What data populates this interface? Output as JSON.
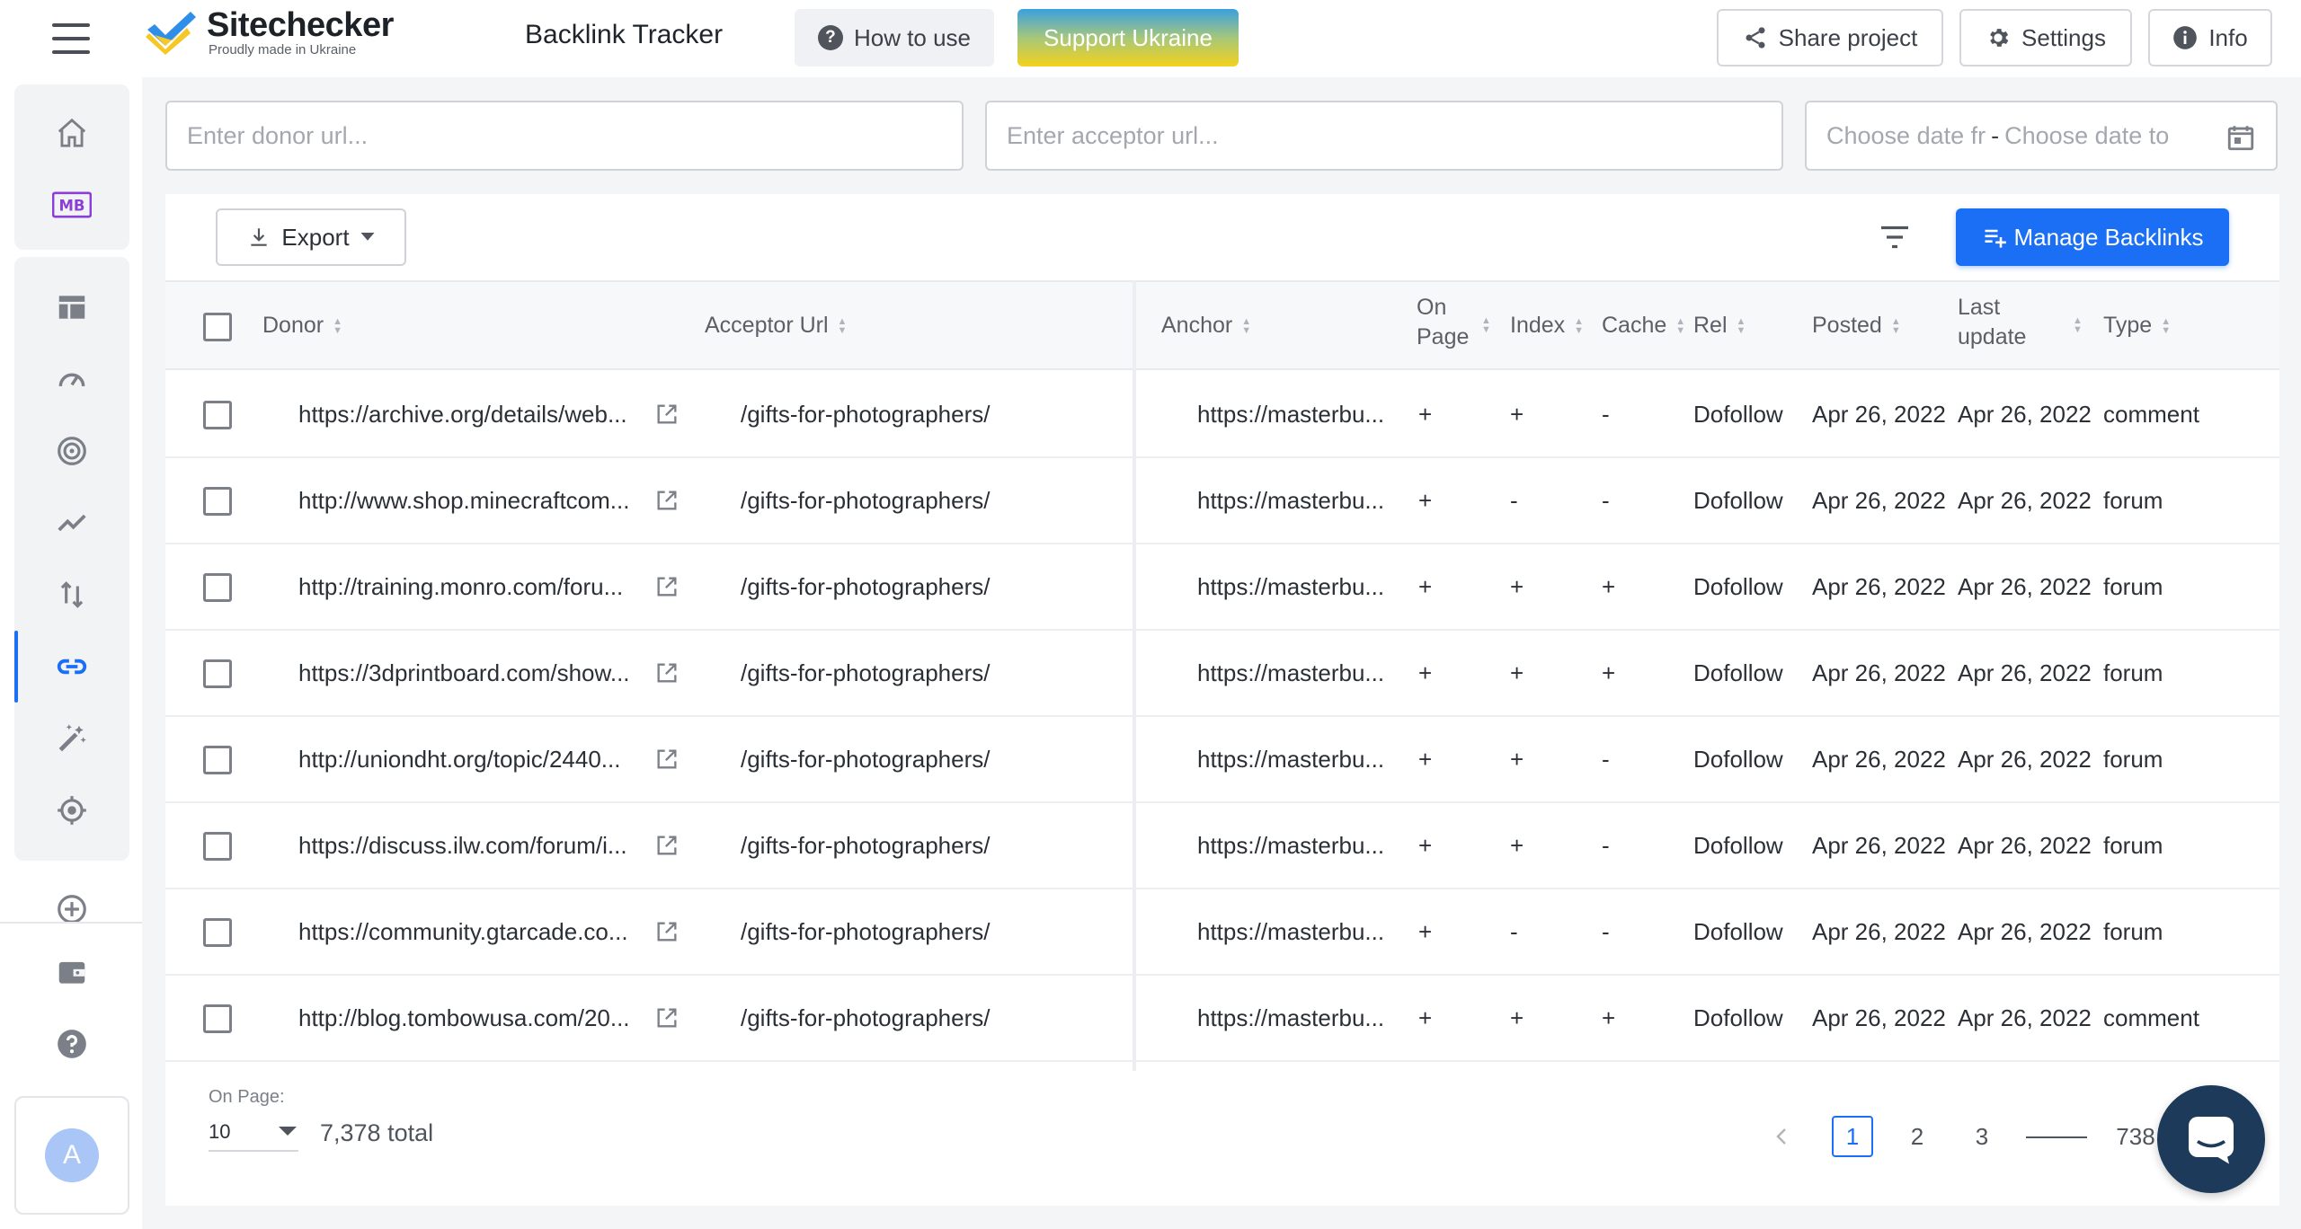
{
  "brand": {
    "name": "Sitechecker",
    "tagline": "Proudly made in Ukraine"
  },
  "header": {
    "app_title": "Backlink Tracker",
    "how_to_use": "How to use",
    "support_ukraine": "Support Ukraine",
    "share": "Share project",
    "settings": "Settings",
    "info": "Info"
  },
  "sidebar": {
    "items": [
      "home-icon",
      "mb-logo",
      "table-icon",
      "speedometer-icon",
      "target-icon",
      "trend-icon",
      "sort-arrows-icon",
      "link-icon",
      "magic-wand-icon",
      "crosshair-icon",
      "add-circle-icon",
      "wallet-icon",
      "help-icon"
    ],
    "active": "link-icon",
    "avatar_letter": "A",
    "mb_label": "MB"
  },
  "filters": {
    "donor_placeholder": "Enter donor url...",
    "acceptor_placeholder": "Enter acceptor url...",
    "date_from_placeholder": "Choose date fr",
    "date_separator": "-",
    "date_to_placeholder": "Choose date to"
  },
  "toolbar": {
    "export": "Export",
    "manage": "Manage Backlinks"
  },
  "table": {
    "columns": {
      "donor": "Donor",
      "acceptor": "Acceptor Url",
      "anchor": "Anchor",
      "onpage_1": "On",
      "onpage_2": "Page",
      "index": "Index",
      "cache": "Cache",
      "rel": "Rel",
      "posted": "Posted",
      "lastupdate_1": "Last",
      "lastupdate_2": "update",
      "type": "Type"
    },
    "rows": [
      {
        "donor": "https://archive.org/details/web...",
        "acceptor": "/gifts-for-photographers/",
        "anchor": "https://masterbu...",
        "onpage": "+",
        "index": "+",
        "cache": "-",
        "rel": "Dofollow",
        "posted": "Apr 26, 2022",
        "updated": "Apr 26, 2022",
        "type": "comment"
      },
      {
        "donor": "http://www.shop.minecraftcom...",
        "acceptor": "/gifts-for-photographers/",
        "anchor": "https://masterbu...",
        "onpage": "+",
        "index": "-",
        "cache": "-",
        "rel": "Dofollow",
        "posted": "Apr 26, 2022",
        "updated": "Apr 26, 2022",
        "type": "forum"
      },
      {
        "donor": "http://training.monro.com/foru...",
        "acceptor": "/gifts-for-photographers/",
        "anchor": "https://masterbu...",
        "onpage": "+",
        "index": "+",
        "cache": "+",
        "rel": "Dofollow",
        "posted": "Apr 26, 2022",
        "updated": "Apr 26, 2022",
        "type": "forum"
      },
      {
        "donor": "https://3dprintboard.com/show...",
        "acceptor": "/gifts-for-photographers/",
        "anchor": "https://masterbu...",
        "onpage": "+",
        "index": "+",
        "cache": "+",
        "rel": "Dofollow",
        "posted": "Apr 26, 2022",
        "updated": "Apr 26, 2022",
        "type": "forum"
      },
      {
        "donor": "http://uniondht.org/topic/2440...",
        "acceptor": "/gifts-for-photographers/",
        "anchor": "https://masterbu...",
        "onpage": "+",
        "index": "+",
        "cache": "-",
        "rel": "Dofollow",
        "posted": "Apr 26, 2022",
        "updated": "Apr 26, 2022",
        "type": "forum"
      },
      {
        "donor": "https://discuss.ilw.com/forum/i...",
        "acceptor": "/gifts-for-photographers/",
        "anchor": "https://masterbu...",
        "onpage": "+",
        "index": "+",
        "cache": "-",
        "rel": "Dofollow",
        "posted": "Apr 26, 2022",
        "updated": "Apr 26, 2022",
        "type": "forum"
      },
      {
        "donor": "https://community.gtarcade.co...",
        "acceptor": "/gifts-for-photographers/",
        "anchor": "https://masterbu...",
        "onpage": "+",
        "index": "-",
        "cache": "-",
        "rel": "Dofollow",
        "posted": "Apr 26, 2022",
        "updated": "Apr 26, 2022",
        "type": "forum"
      },
      {
        "donor": "http://blog.tombowusa.com/20...",
        "acceptor": "/gifts-for-photographers/",
        "anchor": "https://masterbu...",
        "onpage": "+",
        "index": "+",
        "cache": "+",
        "rel": "Dofollow",
        "posted": "Apr 26, 2022",
        "updated": "Apr 26, 2022",
        "type": "comment"
      }
    ]
  },
  "footer": {
    "onpage_label": "On Page:",
    "onpage_value": "10",
    "total": "7,378 total",
    "pages": [
      "1",
      "2",
      "3"
    ],
    "last_page": "738",
    "current_page": "1"
  },
  "colors": {
    "accent": "#1a6ff5",
    "chat": "#1e3a5a"
  }
}
